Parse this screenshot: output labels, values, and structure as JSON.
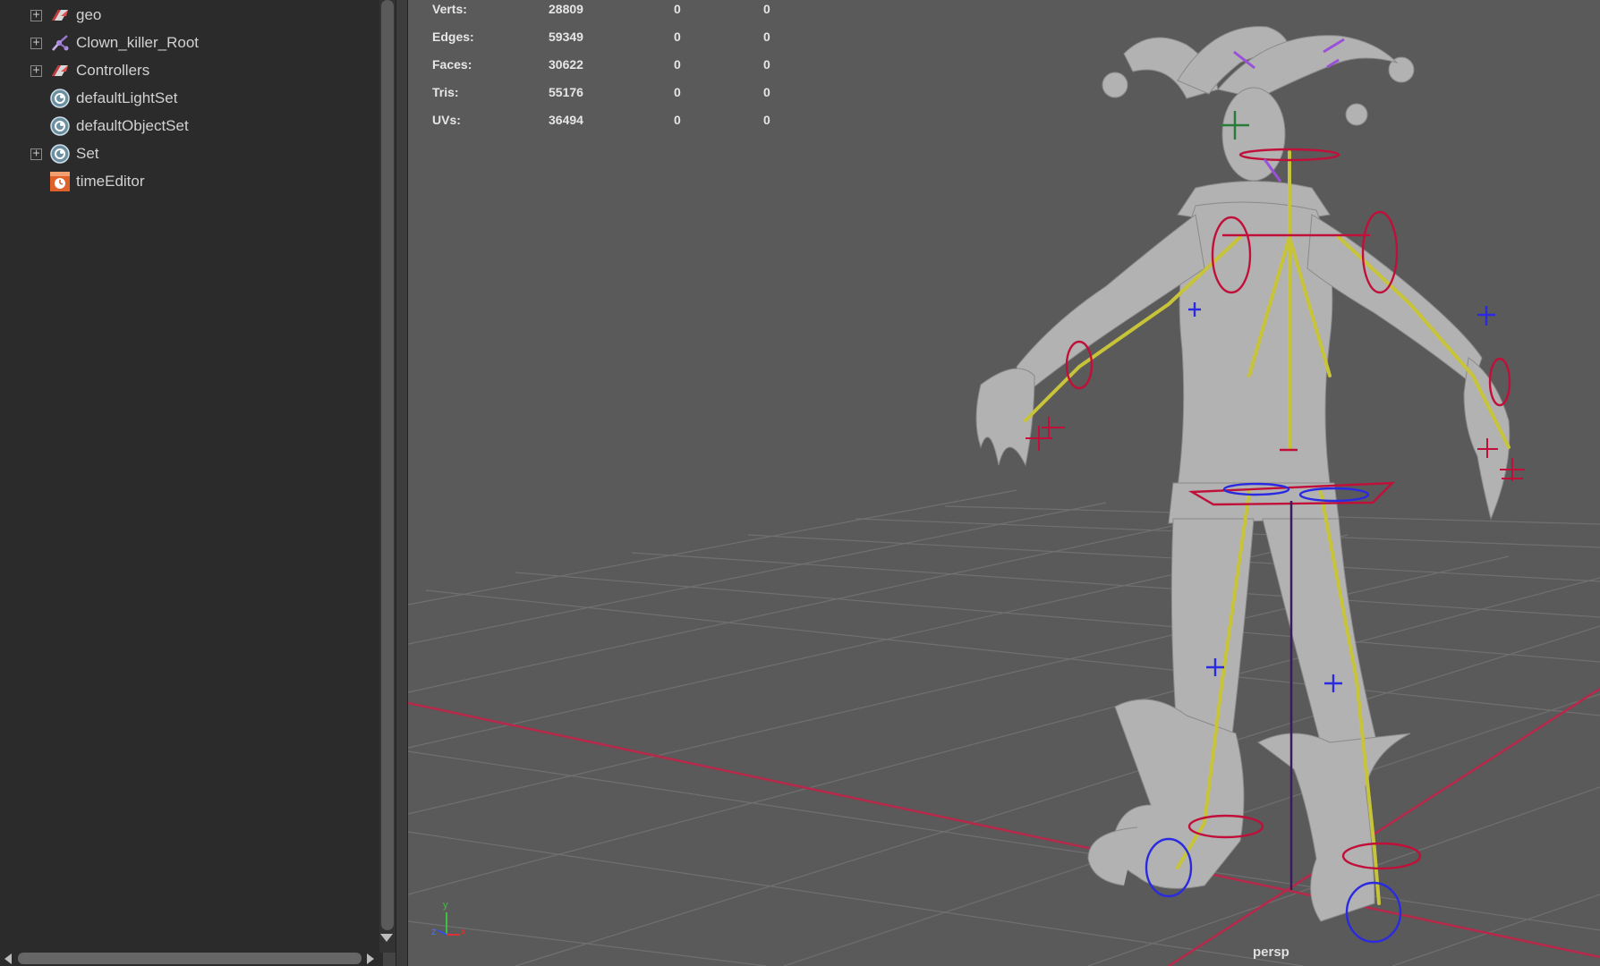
{
  "outliner": {
    "items": [
      {
        "label": "geo",
        "icon": "transform-icon",
        "expandable": true
      },
      {
        "label": "Clown_killer_Root",
        "icon": "joint-icon",
        "expandable": true
      },
      {
        "label": "Controllers",
        "icon": "transform-icon",
        "expandable": true
      },
      {
        "label": "defaultLightSet",
        "icon": "set-icon",
        "expandable": false
      },
      {
        "label": "defaultObjectSet",
        "icon": "set-icon",
        "expandable": false
      },
      {
        "label": "Set",
        "icon": "set-icon",
        "expandable": true
      },
      {
        "label": "timeEditor",
        "icon": "time-editor-icon",
        "expandable": false
      }
    ],
    "expand_glyph": "+"
  },
  "hud": {
    "rows": [
      {
        "label": "Verts:",
        "value": "28809",
        "c2": "0",
        "c3": "0"
      },
      {
        "label": "Edges:",
        "value": "59349",
        "c2": "0",
        "c3": "0"
      },
      {
        "label": "Faces:",
        "value": "30622",
        "c2": "0",
        "c3": "0"
      },
      {
        "label": "Tris:",
        "value": "55176",
        "c2": "0",
        "c3": "0"
      },
      {
        "label": "UVs:",
        "value": "36494",
        "c2": "0",
        "c3": "0"
      }
    ]
  },
  "viewport": {
    "camera": "persp",
    "axis_labels": {
      "x": "x",
      "y": "y",
      "z": "z"
    }
  },
  "colors": {
    "grid_line": "#6e6e6e",
    "grid_axis": "#c0304a",
    "bone": "#c8c43a",
    "ctrl_red": "#c0103a",
    "ctrl_blue": "#2a2ae0",
    "mesh": "#b4b4b4"
  }
}
